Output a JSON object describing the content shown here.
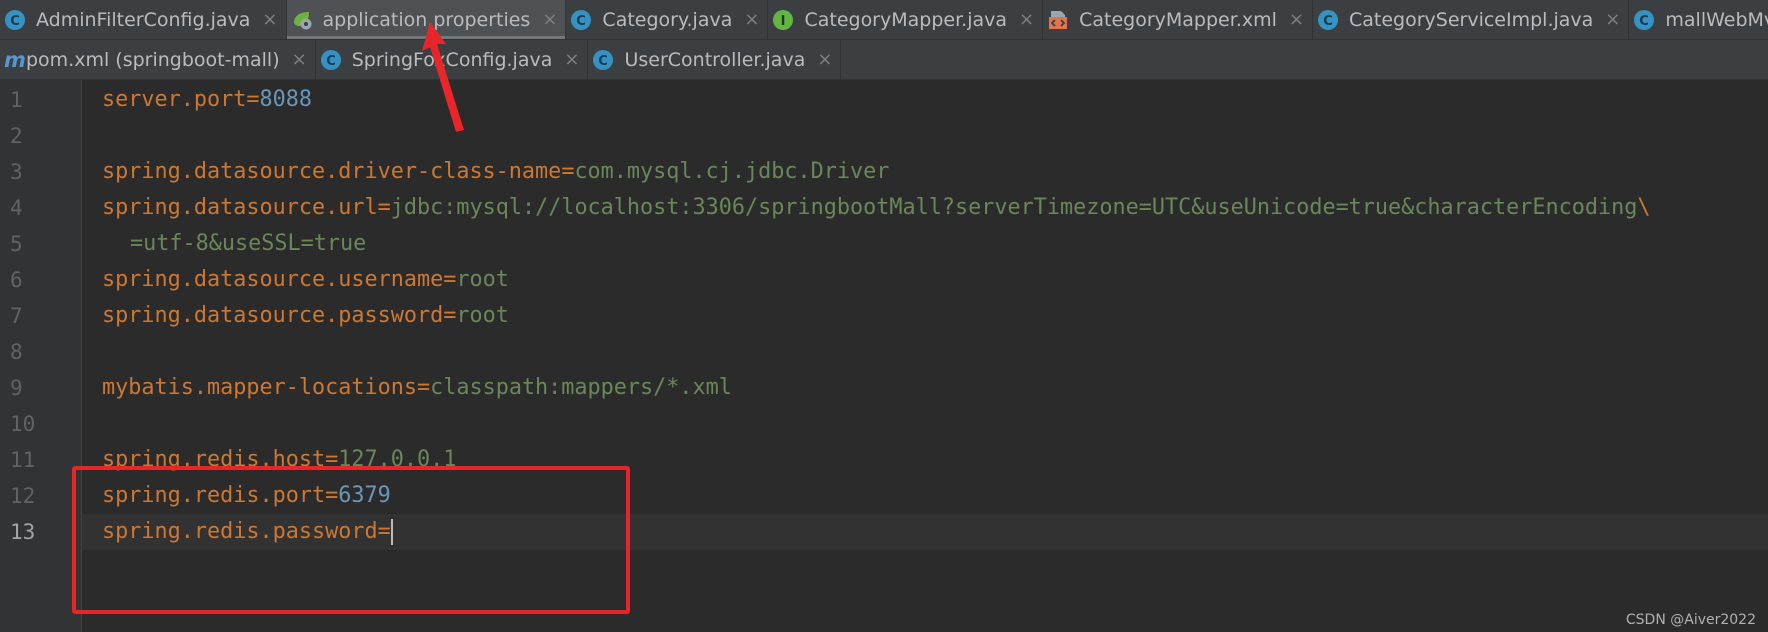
{
  "tabs_row1": [
    {
      "label": "AdminFilterConfig.java",
      "icon": "class-icon",
      "active": false
    },
    {
      "label": "application.properties",
      "icon": "spring-properties-icon",
      "active": true
    },
    {
      "label": "Category.java",
      "icon": "class-icon",
      "active": false
    },
    {
      "label": "CategoryMapper.java",
      "icon": "interface-icon",
      "active": false
    },
    {
      "label": "CategoryMapper.xml",
      "icon": "xml-icon",
      "active": false
    },
    {
      "label": "CategoryServiceImpl.java",
      "icon": "class-icon",
      "active": false
    },
    {
      "label": "mallWebMvcConfig.java",
      "icon": "class-icon",
      "active": false
    }
  ],
  "tabs_row2": [
    {
      "label": "pom.xml (springboot-mall)",
      "icon": "maven-icon",
      "active": false
    },
    {
      "label": "SpringFoxConfig.java",
      "icon": "class-icon",
      "active": false
    },
    {
      "label": "UserController.java",
      "icon": "class-icon",
      "active": false
    }
  ],
  "icon_glyphs": {
    "class": "C",
    "interface": "I",
    "maven": "m"
  },
  "close_glyph": "×",
  "editor": {
    "current_line": 13,
    "lines": [
      {
        "num": "1",
        "key": "server.port",
        "sep": "=",
        "value": "8088",
        "value_type": "number"
      },
      {
        "num": "2",
        "key": "",
        "sep": "",
        "value": "",
        "value_type": "string"
      },
      {
        "num": "3",
        "key": "spring.datasource.driver-class-name",
        "sep": "=",
        "value": "com.mysql.cj.jdbc.Driver",
        "value_type": "class"
      },
      {
        "num": "4",
        "key": "spring.datasource.url",
        "sep": "=",
        "value": "jdbc:mysql://localhost:3306/springbootMall?serverTimezone=UTC&useUnicode=true&characterEncoding",
        "value_type": "string",
        "continuation": "\\"
      },
      {
        "num": "5",
        "key": "",
        "sep": "",
        "value": "=utf-8&useSSL=true",
        "value_type": "string",
        "wrapped": true
      },
      {
        "num": "6",
        "key": "spring.datasource.username",
        "sep": "=",
        "value": "root",
        "value_type": "string"
      },
      {
        "num": "7",
        "key": "spring.datasource.password",
        "sep": "=",
        "value": "root",
        "value_type": "string"
      },
      {
        "num": "8",
        "key": "",
        "sep": "",
        "value": "",
        "value_type": "string"
      },
      {
        "num": "9",
        "key": "mybatis.mapper-locations",
        "sep": "=",
        "value": "classpath:mappers/*.xml",
        "value_type": "string",
        "key_class": "mybatis"
      },
      {
        "num": "10",
        "key": "",
        "sep": "",
        "value": "",
        "value_type": "string"
      },
      {
        "num": "11",
        "key": "spring.redis.host",
        "sep": "=",
        "value": "127.0.0.1",
        "value_type": "string"
      },
      {
        "num": "12",
        "key": "spring.redis.port",
        "sep": "=",
        "value": "6379",
        "value_type": "number"
      },
      {
        "num": "13",
        "key": "spring.redis.password",
        "sep": "=",
        "value": "",
        "value_type": "string"
      }
    ]
  },
  "colors": {
    "background": "#2b2b2b",
    "key": "#cc7832",
    "string_value": "#6a8759",
    "number_value": "#6897bb",
    "annotation": "#e8262a"
  },
  "watermark": "CSDN @Aiver2022"
}
